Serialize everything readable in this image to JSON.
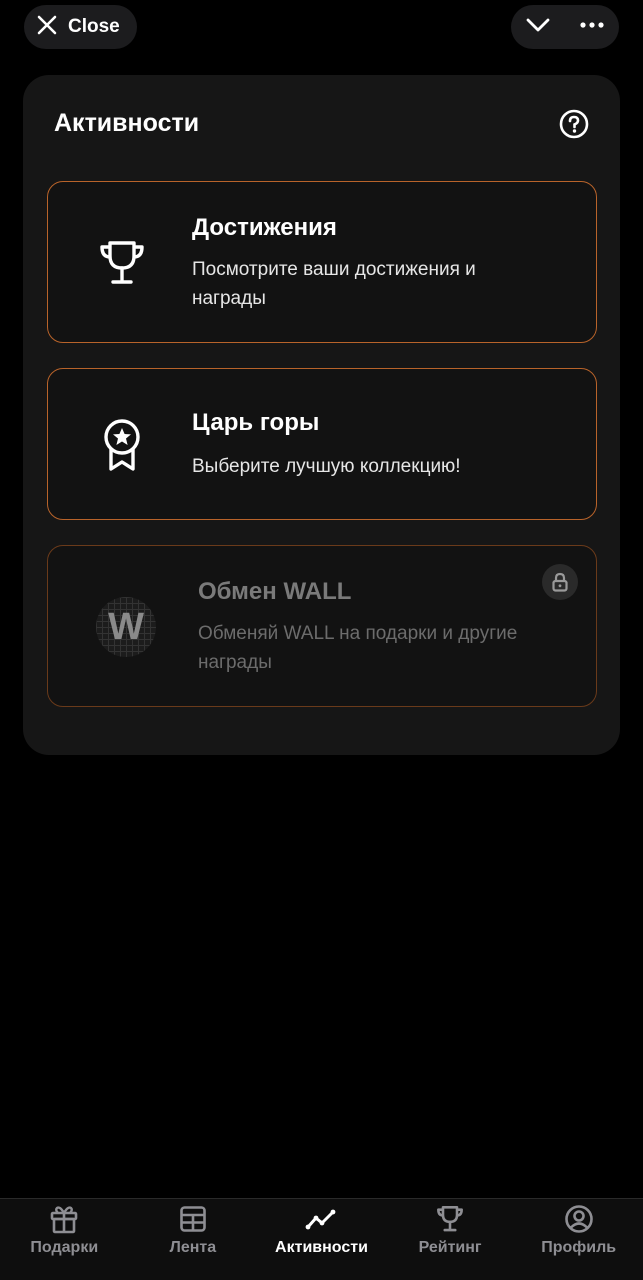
{
  "topbar": {
    "close_label": "Close"
  },
  "panel": {
    "title": "Активности",
    "cards": [
      {
        "title": "Достижения",
        "desc_line1": "Посмотрите ваши достижения и",
        "desc_line2": "награды",
        "icon": "trophy-icon",
        "locked": false
      },
      {
        "title": "Царь горы",
        "desc_line1": "Выберите лучшую коллекцию!",
        "desc_line2": "",
        "icon": "award-badge-icon",
        "locked": false
      },
      {
        "title": "Обмен WALL",
        "desc_line1": "Обменяй WALL на подарки и другие",
        "desc_line2": "награды",
        "icon": "wall-logo",
        "logo_letter": "W",
        "locked": true
      }
    ]
  },
  "nav": {
    "items": [
      {
        "label": "Подарки",
        "icon": "gift-icon",
        "active": false
      },
      {
        "label": "Лента",
        "icon": "table-icon",
        "active": false
      },
      {
        "label": "Активности",
        "icon": "activity-icon",
        "active": true
      },
      {
        "label": "Рейтинг",
        "icon": "trophy-icon",
        "active": false
      },
      {
        "label": "Профиль",
        "icon": "profile-icon",
        "active": false
      }
    ]
  },
  "colors": {
    "card_border": "#b8632a",
    "background": "#000000",
    "panel": "#161616"
  }
}
